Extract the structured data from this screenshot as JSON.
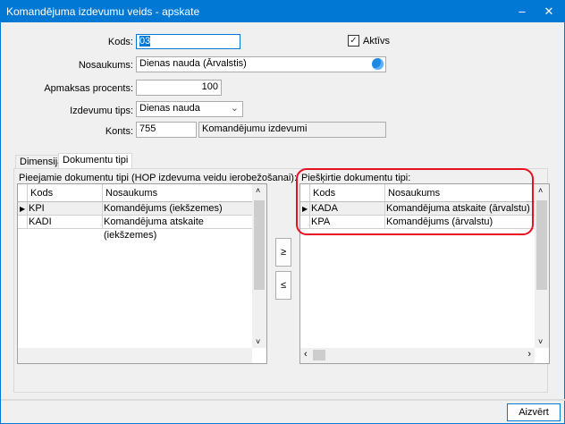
{
  "window": {
    "title": "Komandējuma izdevumu veids - apskate",
    "minimize": "–",
    "close": "✕"
  },
  "form": {
    "kods_label": "Kods:",
    "kods_value": "03",
    "aktivs_label": "Aktīvs",
    "aktivs_checked": true,
    "check": "✓",
    "nosaukums_label": "Nosaukums:",
    "nosaukums_value": "Dienas nauda (Ārvalstis)",
    "apmaksas_label": "Apmaksas procents:",
    "apmaksas_value": "100",
    "tips_label": "Izdevumu tips:",
    "tips_value": "Dienas nauda",
    "konts_label": "Konts:",
    "konts_code": "755",
    "konts_name": "Komandējumu izdevumi"
  },
  "tabs": [
    {
      "label": "Dimensijas",
      "active": false
    },
    {
      "label": "Dokumentu tipi",
      "active": true
    }
  ],
  "left": {
    "title": "Pieejamie dokumentu tipi (HOP izdevuma veidu ierobežošanai):",
    "headers": [
      "Kods",
      "Nosaukums"
    ],
    "rows": [
      {
        "kods": "KPI",
        "nosaukums": "Komandējums (iekšzemes)"
      },
      {
        "kods": "KADI",
        "nosaukums": "Komandējuma atskaite (iekšzemes)"
      }
    ]
  },
  "right": {
    "title": "Piešķirtie dokumentu tipi:",
    "headers": [
      "Kods",
      "Nosaukums"
    ],
    "rows": [
      {
        "kods": "KADA",
        "nosaukums": "Komandējuma atskaite (ārvalstu)"
      },
      {
        "kods": "KPA",
        "nosaukums": "Komandējums (ārvalstu)"
      }
    ]
  },
  "move": {
    "add": "≥",
    "remove": "≤"
  },
  "footer": {
    "close_label": "Aizvērt"
  },
  "colors": {
    "accent": "#0078d4",
    "highlight": "#e81123"
  }
}
